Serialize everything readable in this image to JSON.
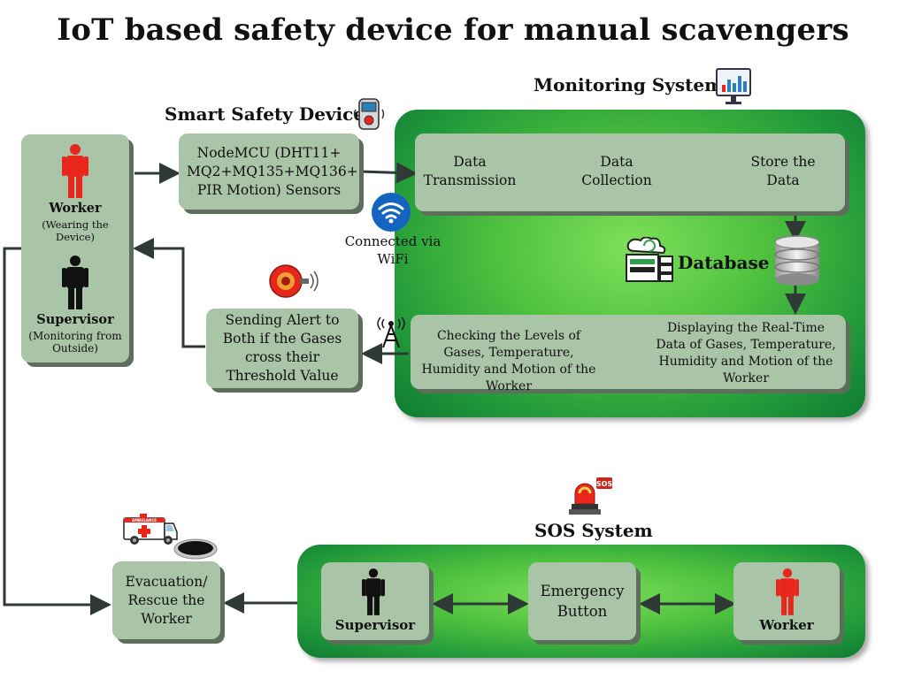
{
  "title": "IoT based safety device for manual scavengers",
  "sections": {
    "monitoring": "Monitoring System",
    "smart_device": "Smart Safety Device",
    "database": "Database",
    "sos": "SOS System"
  },
  "people_box": {
    "worker_label": "Worker",
    "worker_note": "(Wearing the Device)",
    "supervisor_label": "Supervisor",
    "supervisor_note": "(Monitoring from Outside)"
  },
  "sensor_box": "NodeMCU (DHT11+ MQ2+MQ135+MQ136+ PIR Motion) Sensors",
  "wifi_label": "Connected via WiFi",
  "alert_box": "Sending Alert to Both if the Gases cross their Threshold Value",
  "monitoring_steps": {
    "transmission": "Data Transmission",
    "collection": "Data Collection",
    "store": "Store the Data",
    "checking": "Checking the Levels of Gases, Temperature, Humidity and Motion of the Worker",
    "displaying": "Displaying the Real-Time Data of Gases, Temperature, Humidity and Motion of the Worker"
  },
  "evacuation_box": "Evacuation/ Rescue the Worker",
  "ambulance_text": "AMBULANCE",
  "sos_badge": "SOS",
  "sos_nodes": {
    "supervisor": "Supervisor",
    "button": "Emergency Button",
    "worker": "Worker"
  },
  "colors": {
    "box_fill": "#a9c4a7",
    "panel_green": "#2fa63c",
    "worker_red": "#e8261c",
    "supervisor_black": "#111111"
  }
}
